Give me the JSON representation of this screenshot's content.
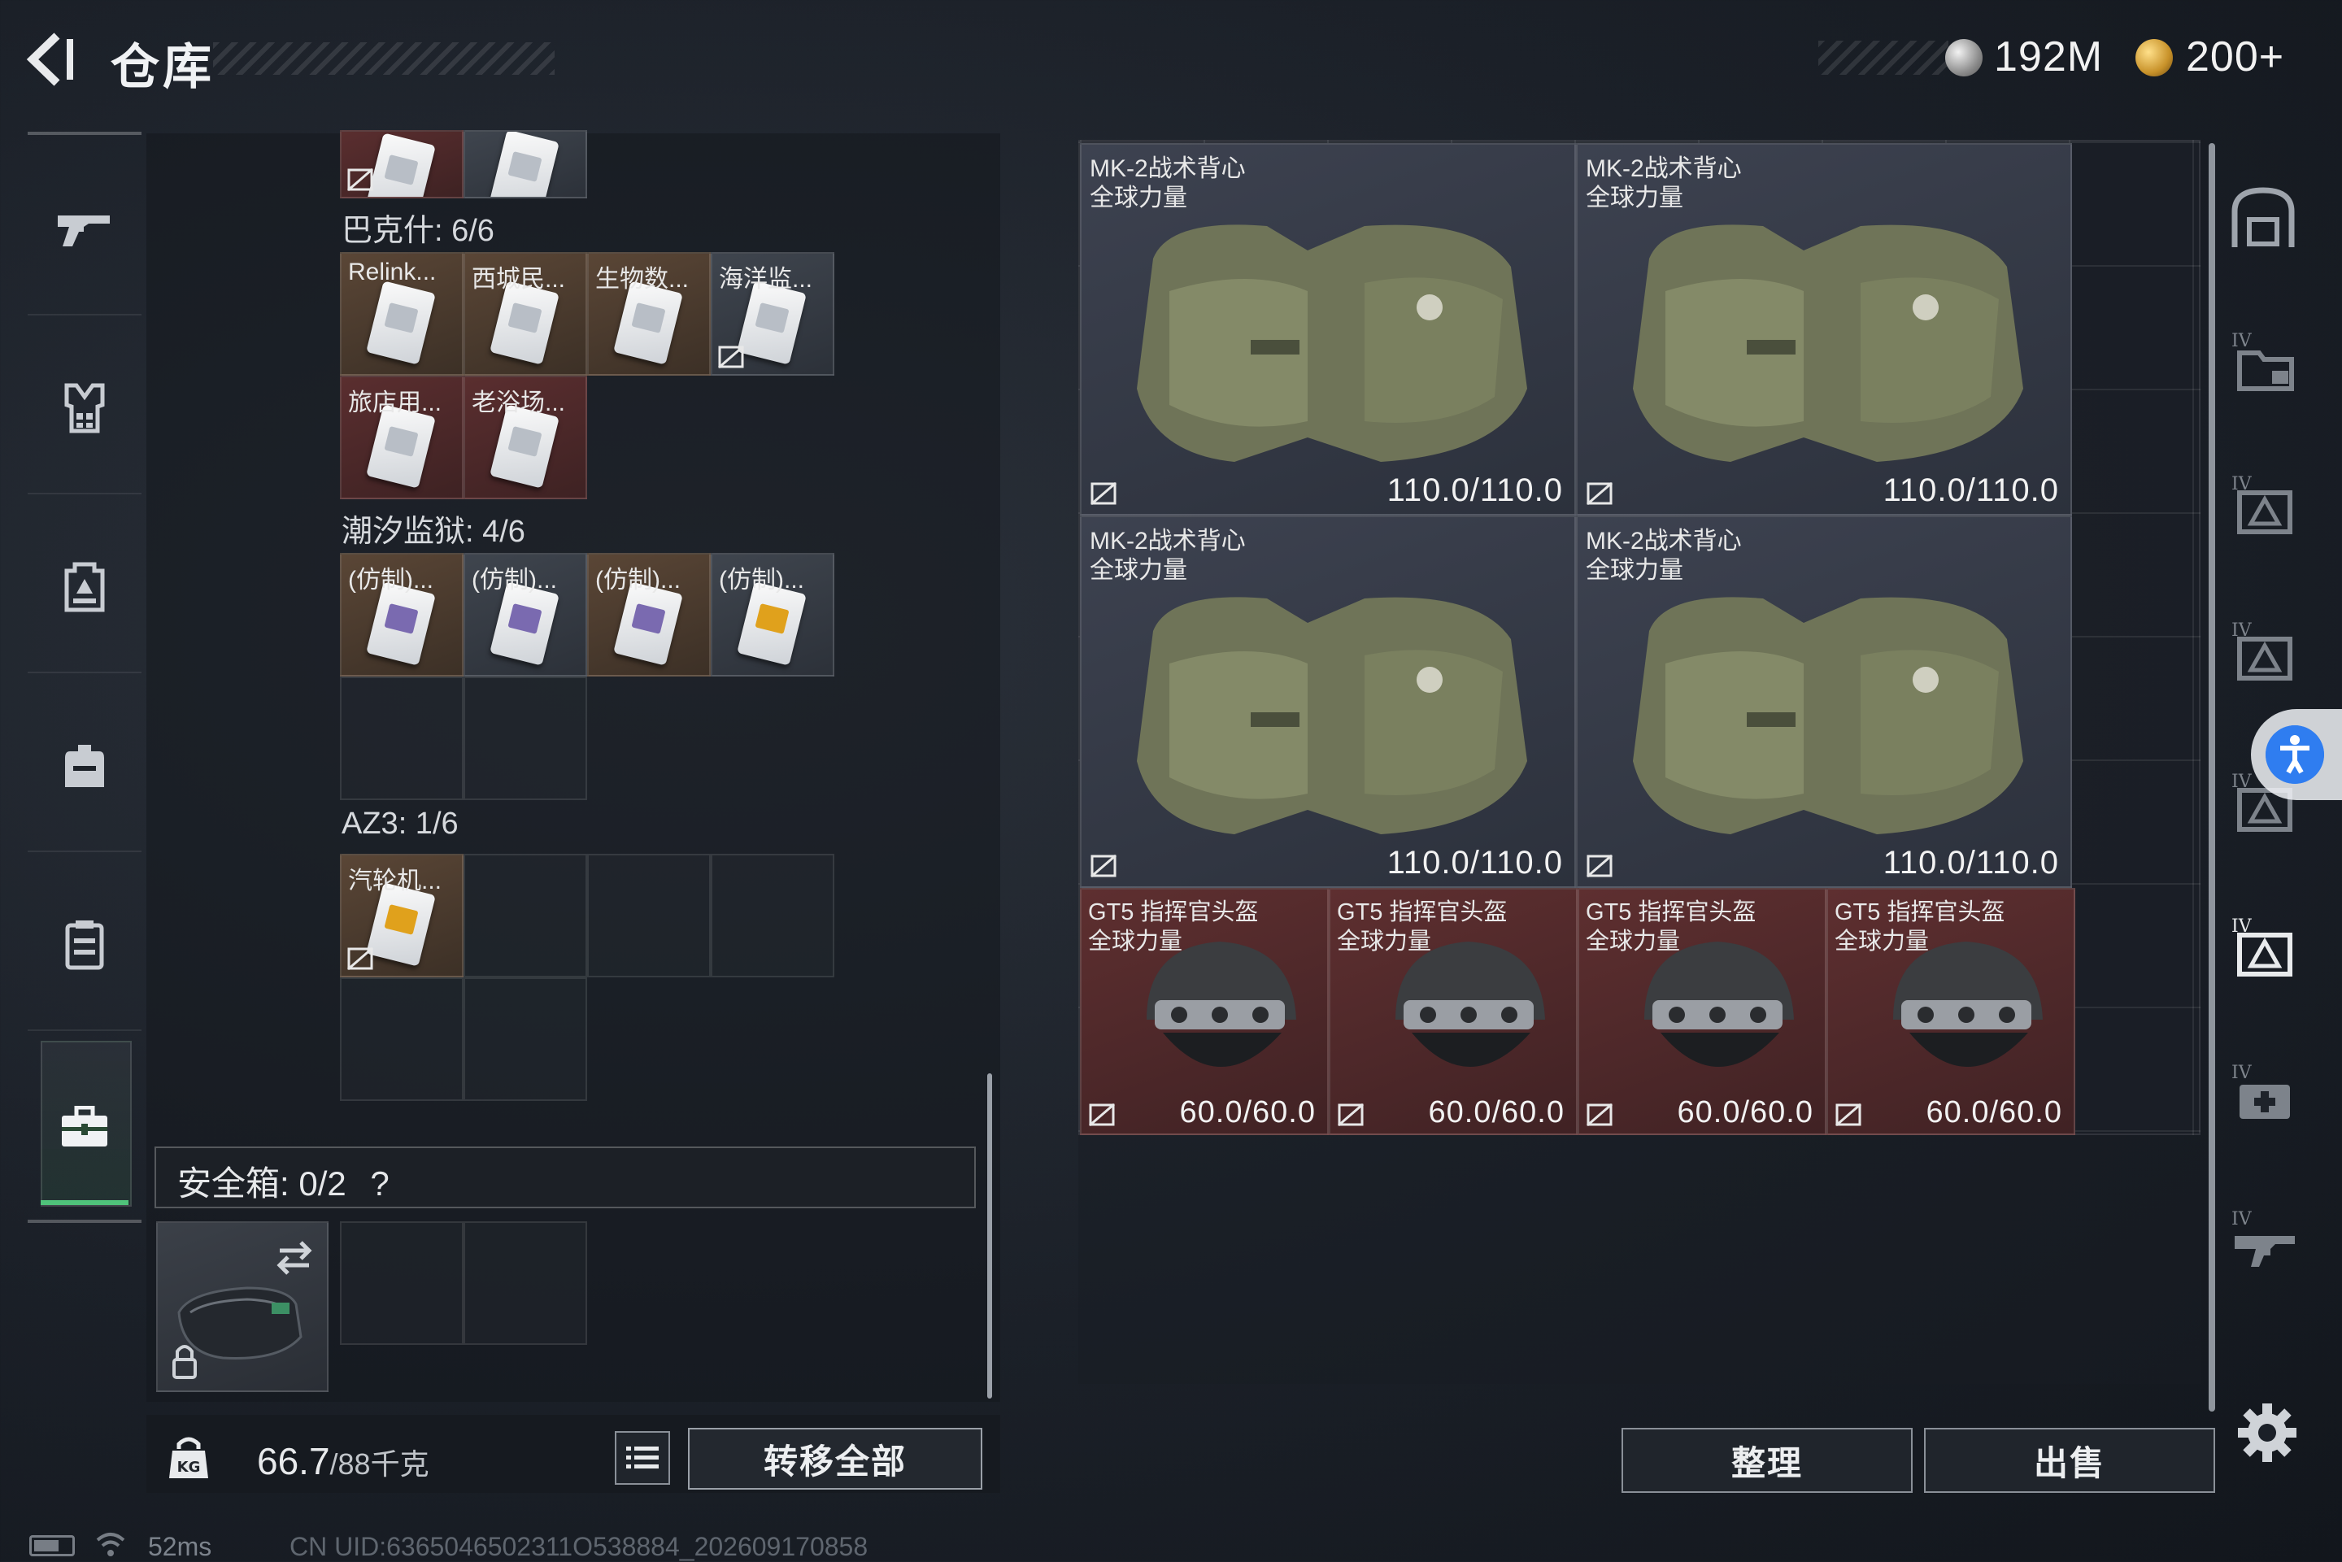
{
  "header": {
    "title": "仓库",
    "currency": [
      {
        "icon": "silver-coin-icon",
        "value": "192M"
      },
      {
        "icon": "gold-coin-icon",
        "value": "200+"
      }
    ]
  },
  "sidebar": {
    "items": [
      {
        "name": "weapon-icon"
      },
      {
        "name": "armor-vest-icon"
      },
      {
        "name": "chest-rig-icon"
      },
      {
        "name": "backpack-icon"
      },
      {
        "name": "container-icon"
      },
      {
        "name": "toolbox-icon",
        "active": true
      }
    ]
  },
  "storage": {
    "sections": [
      {
        "label": "巴克什: 6/6",
        "items": [
          "Relink...",
          "西城民...",
          "生物数...",
          "海洋监...",
          "旅店用...",
          "老浴场..."
        ]
      },
      {
        "label": "潮汐监狱: 4/6",
        "items": [
          "(仿制)...",
          "(仿制)...",
          "(仿制)...",
          "(仿制)..."
        ]
      },
      {
        "label": "AZ3: 1/6",
        "items": [
          "汽轮机..."
        ]
      }
    ],
    "safe_box": {
      "label": "安全箱: 0/2",
      "help": "?"
    }
  },
  "weight": {
    "current": "66.7",
    "max": "/88千克"
  },
  "buttons": {
    "transfer_all": "转移全部",
    "sort": "整理",
    "sell": "出售"
  },
  "inventory": {
    "vests": [
      {
        "name": "MK-2战术背心",
        "tag": "全球力量",
        "durability": "110.0/110.0"
      },
      {
        "name": "MK-2战术背心",
        "tag": "全球力量",
        "durability": "110.0/110.0"
      },
      {
        "name": "MK-2战术背心",
        "tag": "全球力量",
        "durability": "110.0/110.0"
      },
      {
        "name": "MK-2战术背心",
        "tag": "全球力量",
        "durability": "110.0/110.0"
      }
    ],
    "helmets": [
      {
        "name": "GT5 指挥官头盔",
        "tag": "全球力量",
        "durability": "60.0/60.0"
      },
      {
        "name": "GT5 指挥官头盔",
        "tag": "全球力量",
        "durability": "60.0/60.0"
      },
      {
        "name": "GT5 指挥官头盔",
        "tag": "全球力量",
        "durability": "60.0/60.0"
      },
      {
        "name": "GT5 指挥官头盔",
        "tag": "全球力量",
        "durability": "60.0/60.0"
      }
    ]
  },
  "status_bar": {
    "ping": "52ms",
    "uid": "CN UID:6365046502311O538884_202609170858"
  },
  "colors": {
    "accent_green": "#4fc27a",
    "item_red": "#5e2f30",
    "access_blue": "#2f7df0"
  }
}
